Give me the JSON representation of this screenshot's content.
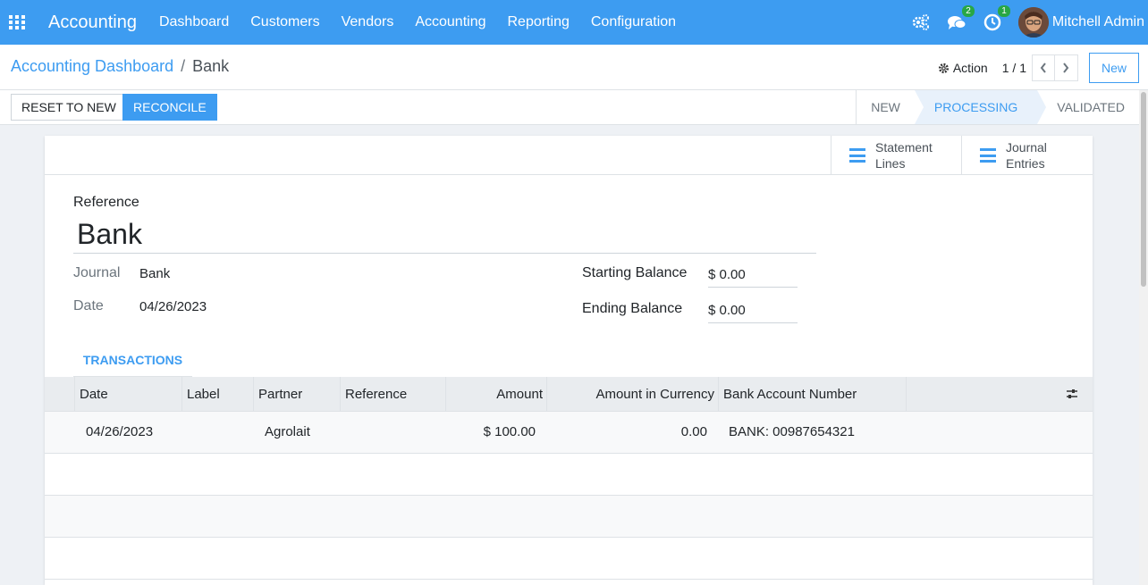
{
  "navbar": {
    "brand": "Accounting",
    "menu": [
      "Dashboard",
      "Customers",
      "Vendors",
      "Accounting",
      "Reporting",
      "Configuration"
    ],
    "messages_badge": "2",
    "activities_badge": "1",
    "user_name": "Mitchell Admin"
  },
  "breadcrumb": {
    "parent": "Accounting Dashboard",
    "separator": "/",
    "current": "Bank"
  },
  "control": {
    "action_label": "Action",
    "pager": "1 / 1",
    "new_label": "New"
  },
  "statusbar": {
    "reset_label": "RESET TO NEW",
    "reconcile_label": "RECONCILE",
    "stages": [
      "NEW",
      "PROCESSING",
      "VALIDATED"
    ],
    "current_stage": "PROCESSING"
  },
  "smart_buttons": [
    {
      "label": "Statement Lines"
    },
    {
      "label": "Journal Entries"
    }
  ],
  "form": {
    "reference_label": "Reference",
    "reference_value": "Bank",
    "journal_label": "Journal",
    "journal_value": "Bank",
    "date_label": "Date",
    "date_value": "04/26/2023",
    "starting_balance_label": "Starting Balance",
    "starting_balance_value": "$ 0.00",
    "ending_balance_label": "Ending Balance",
    "ending_balance_value": "$ 0.00"
  },
  "tabs": {
    "transactions_label": "TRANSACTIONS"
  },
  "table": {
    "columns": [
      "Date",
      "Label",
      "Partner",
      "Reference",
      "Amount",
      "Amount in Currency",
      "Bank Account Number"
    ],
    "rows": [
      {
        "date": "04/26/2023",
        "label": "",
        "partner": "Agrolait",
        "reference": "",
        "amount": "$ 100.00",
        "amount_currency": "0.00",
        "bank_account": "BANK: 00987654321"
      }
    ]
  },
  "colors": {
    "primary": "#3d9cf1",
    "badge": "#28a745"
  }
}
